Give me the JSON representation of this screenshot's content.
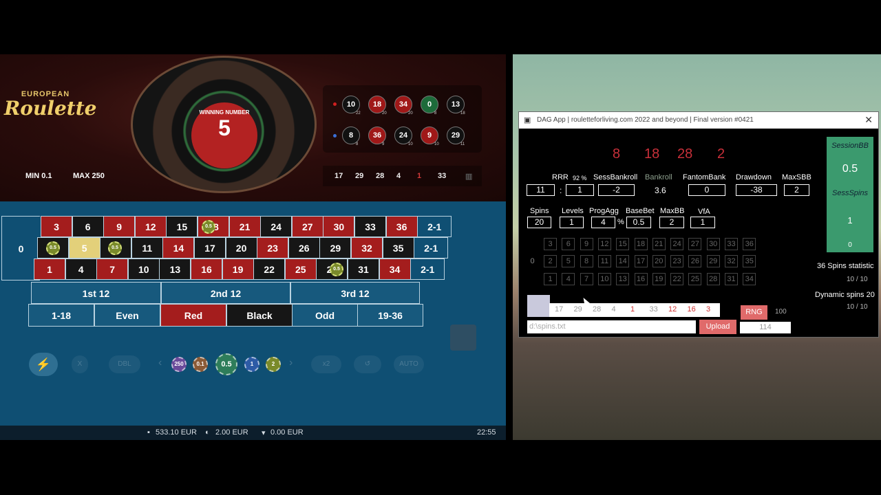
{
  "game": {
    "logo_top": "EUROPEAN",
    "logo_main": "Roulette",
    "min": "MIN 0.1",
    "max": "MAX 250",
    "winning_label": "WINNING NUMBER",
    "winning_number": "5",
    "history_red": [
      {
        "n": "10",
        "c": "black",
        "sub": "22"
      },
      {
        "n": "18",
        "c": "red",
        "sub": "20"
      },
      {
        "n": "34",
        "c": "red",
        "sub": "20"
      },
      {
        "n": "0",
        "c": "green",
        "sub": "8"
      },
      {
        "n": "13",
        "c": "black",
        "sub": "18"
      }
    ],
    "history_blue": [
      {
        "n": "8",
        "c": "black",
        "sub": "8"
      },
      {
        "n": "36",
        "c": "red",
        "sub": "9"
      },
      {
        "n": "24",
        "c": "black",
        "sub": "10"
      },
      {
        "n": "9",
        "c": "red",
        "sub": "10"
      },
      {
        "n": "29",
        "c": "black",
        "sub": "11"
      }
    ],
    "recent": [
      "17",
      "29",
      "28",
      "4",
      "1",
      "33"
    ],
    "board": {
      "zero": "0",
      "row_top": [
        [
          "3",
          "red"
        ],
        [
          "6",
          "black"
        ],
        [
          "9",
          "red"
        ],
        [
          "12",
          "red"
        ],
        [
          "15",
          "black"
        ],
        [
          "18",
          "red"
        ],
        [
          "21",
          "red"
        ],
        [
          "24",
          "black"
        ],
        [
          "27",
          "red"
        ],
        [
          "30",
          "red"
        ],
        [
          "33",
          "black"
        ],
        [
          "36",
          "red"
        ]
      ],
      "row_mid": [
        [
          "2",
          "black"
        ],
        [
          "5",
          "sel"
        ],
        [
          "8",
          "black"
        ],
        [
          "11",
          "black"
        ],
        [
          "14",
          "red"
        ],
        [
          "17",
          "black"
        ],
        [
          "20",
          "black"
        ],
        [
          "23",
          "red"
        ],
        [
          "26",
          "black"
        ],
        [
          "29",
          "black"
        ],
        [
          "32",
          "red"
        ],
        [
          "35",
          "black"
        ]
      ],
      "row_bot": [
        [
          "1",
          "red"
        ],
        [
          "4",
          "black"
        ],
        [
          "7",
          "red"
        ],
        [
          "10",
          "black"
        ],
        [
          "13",
          "black"
        ],
        [
          "16",
          "red"
        ],
        [
          "19",
          "red"
        ],
        [
          "22",
          "black"
        ],
        [
          "25",
          "red"
        ],
        [
          "28",
          "black"
        ],
        [
          "31",
          "black"
        ],
        [
          "34",
          "red"
        ]
      ],
      "columns": [
        "2-1",
        "2-1",
        "2-1"
      ],
      "dozens": [
        "1st 12",
        "2nd 12",
        "3rd 12"
      ],
      "outside": [
        "1-18",
        "Even",
        "Red",
        "Black",
        "Odd",
        "19-36"
      ],
      "chip_label": "0.5"
    },
    "controls": {
      "chips": [
        "250",
        "0.1",
        "0.5",
        "1",
        "2"
      ],
      "ghost": [
        "X",
        "DBL",
        "x2",
        "AUTO"
      ]
    },
    "footer": {
      "balance": "533.10 EUR",
      "bet": "2.00 EUR",
      "win": "0.00 EUR",
      "time": "22:55"
    }
  },
  "app": {
    "title": "DAG App | rouletteforliving.com 2022 and beyond | Final version #0421",
    "bignums": [
      "8",
      "18",
      "28",
      "2"
    ],
    "row1_labels": {
      "rrr": "RRR",
      "rrr_pct": "92 %",
      "sess_bankroll": "SessBankroll",
      "bankroll": "Bankroll",
      "fantom": "FantomBank",
      "drawdown": "Drawdown",
      "maxsbb": "MaxSBB"
    },
    "row1_values": {
      "rrr_a": "11",
      "sep": ":",
      "rrr_b": "1",
      "sess_bankroll": "-2",
      "bankroll": "3.6",
      "fantom": "0",
      "drawdown": "-38",
      "maxsbb": "2"
    },
    "row2_labels": {
      "spins": "Spins",
      "levels": "Levels",
      "progagg": "ProgAgg",
      "basebet": "BaseBet",
      "maxbb": "MaxBB",
      "vfa": "VfA"
    },
    "row2_values": {
      "spins": "20",
      "levels": "1",
      "progagg": "4",
      "pct": "%",
      "basebet": "0.5",
      "maxbb": "2",
      "vfa": "1"
    },
    "session": {
      "bb_label": "SessionBB",
      "bb_value": "0.5",
      "spins_label": "SessSpins",
      "spins_value": "1",
      "zero": "0"
    },
    "grid": {
      "zero": "0",
      "top": [
        "3",
        "6",
        "9",
        "12",
        "15",
        "18",
        "21",
        "24",
        "27",
        "30",
        "33",
        "36"
      ],
      "mid": [
        "2",
        "5",
        "8",
        "11",
        "14",
        "17",
        "20",
        "23",
        "26",
        "29",
        "32",
        "35"
      ],
      "bot": [
        "1",
        "4",
        "7",
        "10",
        "13",
        "16",
        "19",
        "22",
        "25",
        "28",
        "31",
        "34"
      ]
    },
    "spins_strip": [
      {
        "n": "17",
        "c": "#999999"
      },
      {
        "n": "29",
        "c": "#999999"
      },
      {
        "n": "28",
        "c": "#999999"
      },
      {
        "n": "4",
        "c": "#999999"
      },
      {
        "n": "1",
        "c": "#d03030"
      },
      {
        "n": "33",
        "c": "#999999"
      },
      {
        "n": "12",
        "c": "#d03030"
      },
      {
        "n": "16",
        "c": "#d03030"
      },
      {
        "n": "3",
        "c": "#d03030"
      }
    ],
    "rng_label": "RNG",
    "rng_value": "100",
    "path_placeholder": "d:\\spins.txt",
    "upload_label": "Upload",
    "count_value": "114",
    "stats": {
      "s36_label": "36 Spins statistic",
      "s36_value": "10 / 10",
      "dyn_label": "Dynamic spins 20",
      "dyn_value": "10 / 10"
    }
  }
}
